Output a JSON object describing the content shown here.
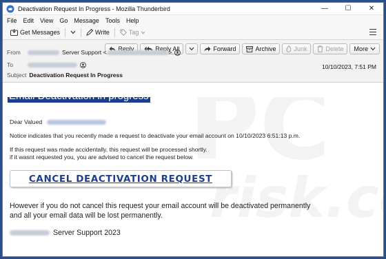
{
  "window": {
    "title": "Deactivation Request In Progress - Mozilla Thunderbird",
    "controls": {
      "minimize": "—",
      "maximize": "☐",
      "close": "✕"
    }
  },
  "menubar": {
    "items": [
      {
        "label": "File"
      },
      {
        "label": "Edit"
      },
      {
        "label": "View"
      },
      {
        "label": "Go"
      },
      {
        "label": "Message"
      },
      {
        "label": "Tools"
      },
      {
        "label": "Help"
      }
    ]
  },
  "toolbar": {
    "get_messages": "Get Messages",
    "write": "Write",
    "tag": "Tag"
  },
  "header_buttons": {
    "reply": "Reply",
    "reply_all": "Reply All",
    "forward": "Forward",
    "archive": "Archive",
    "junk": "Junk",
    "delete": "Delete",
    "more": "More"
  },
  "headers": {
    "from_label": "From",
    "from_name": "Server Support <",
    "from_end": ">",
    "to_label": "To",
    "subject_label": "Subject",
    "subject": "Deactivation Request In Progress",
    "date": "10/10/2023, 7:51 PM"
  },
  "body": {
    "headline": "Email Deactivation in progress",
    "greeting": "Dear Valued",
    "notice": "Notice indicates that you recently made a request to deactivate your email account on 10/10/2023 6:51:13 p.m.",
    "accidental_1": "If this request was made accidentally, this request will be processed shortly.",
    "accidental_2": "if it wasnt requested you, you are advised to cancel the request below.",
    "cancel_button": "CANCEL DEACTIVATION REQUEST",
    "warning_1": "However if you do not cancel this request your email account will be deactivated permanently",
    "warning_2": "and all your email data will be lost permanently.",
    "signature": "Server Support 2023",
    "watermark_top": "PC",
    "watermark_bottom": "risk.com"
  },
  "colors": {
    "brand_blue": "#1b3f8b",
    "background_frame": "#2b4f8a"
  }
}
